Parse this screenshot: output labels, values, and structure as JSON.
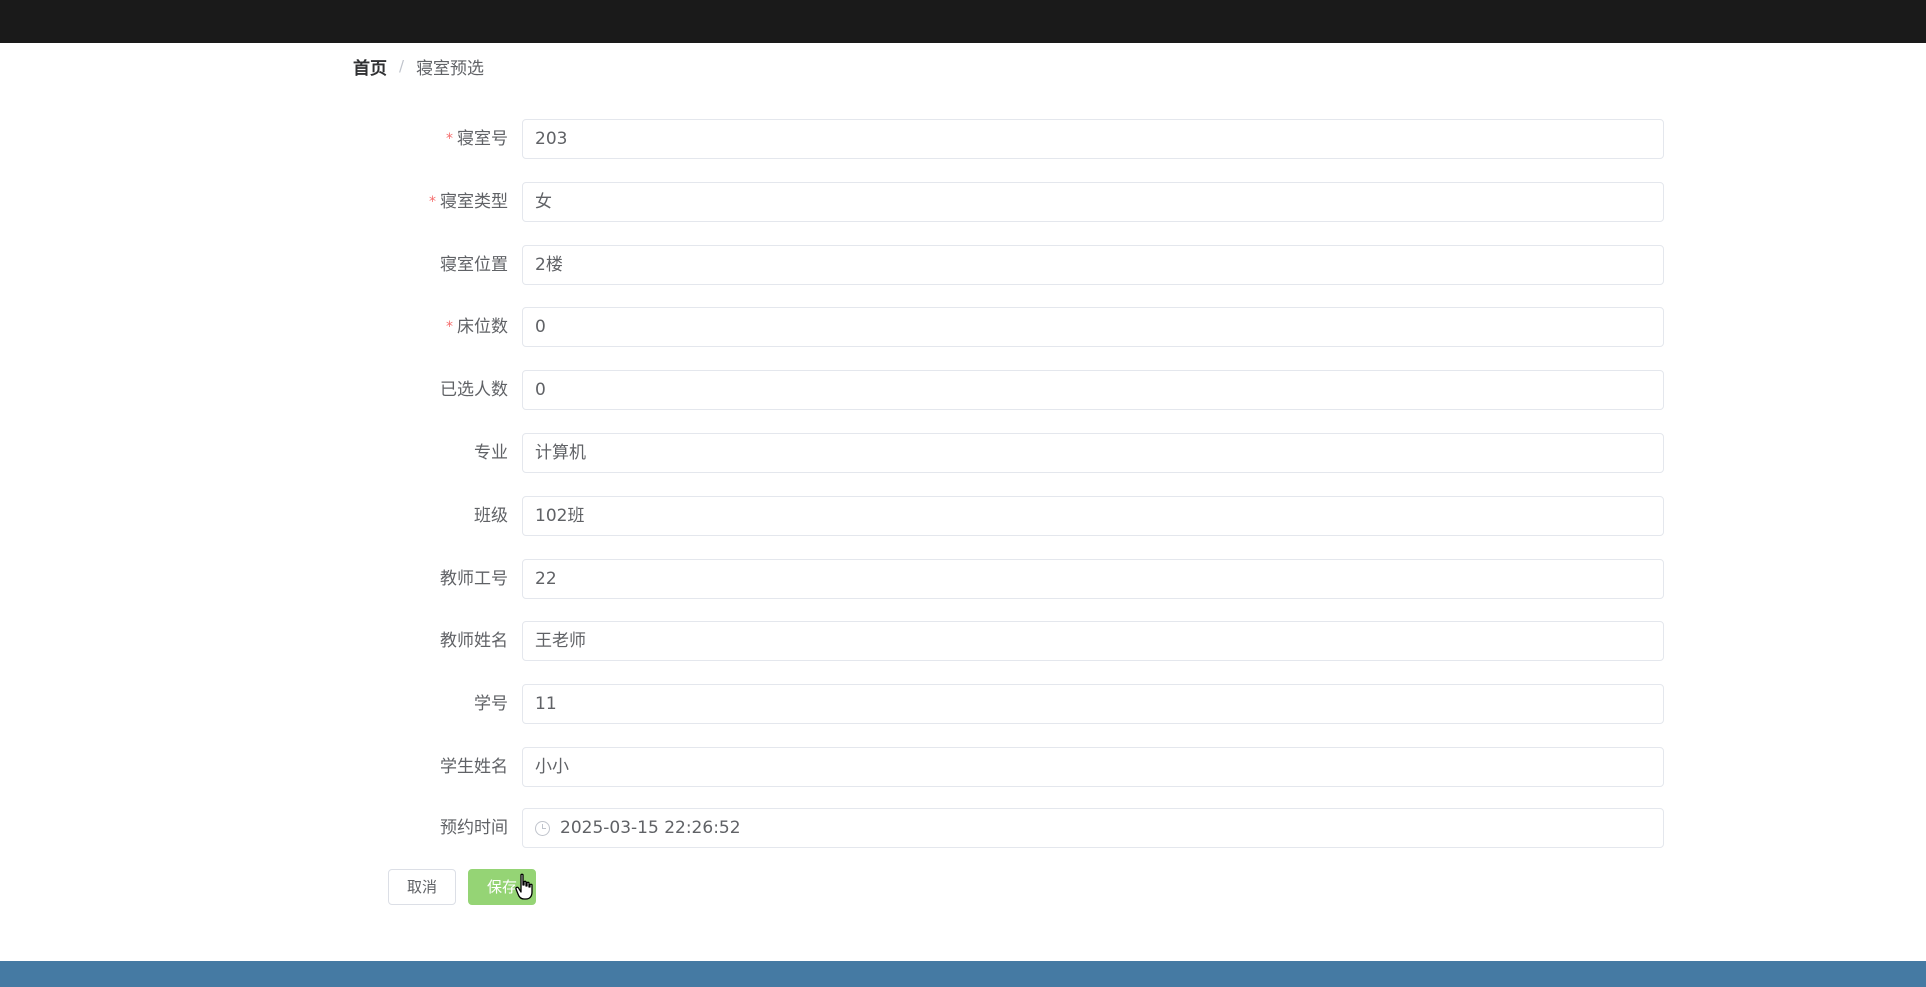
{
  "breadcrumb": {
    "home": "首页",
    "separator": "/",
    "current": "寝室预选"
  },
  "form": {
    "fields": [
      {
        "label": "寝室号",
        "required": true,
        "value": "203"
      },
      {
        "label": "寝室类型",
        "required": true,
        "value": "女"
      },
      {
        "label": "寝室位置",
        "required": false,
        "value": "2楼"
      },
      {
        "label": "床位数",
        "required": true,
        "value": "0"
      },
      {
        "label": "已选人数",
        "required": false,
        "value": "0"
      },
      {
        "label": "专业",
        "required": false,
        "value": "计算机"
      },
      {
        "label": "班级",
        "required": false,
        "value": "102班"
      },
      {
        "label": "教师工号",
        "required": false,
        "value": "22"
      },
      {
        "label": "教师姓名",
        "required": false,
        "value": "王老师"
      },
      {
        "label": "学号",
        "required": false,
        "value": "11"
      },
      {
        "label": "学生姓名",
        "required": false,
        "value": "小小"
      },
      {
        "label": "预约时间",
        "required": false,
        "value": "2025-03-15 22:26:52",
        "icon": "clock-icon"
      }
    ],
    "required_mark": "*"
  },
  "buttons": {
    "cancel": "取消",
    "save": "保存"
  },
  "colors": {
    "topbar": "#1a1a1a",
    "bottombar": "#457aa3",
    "save_button": "#95d475",
    "required": "#f56c6c"
  }
}
